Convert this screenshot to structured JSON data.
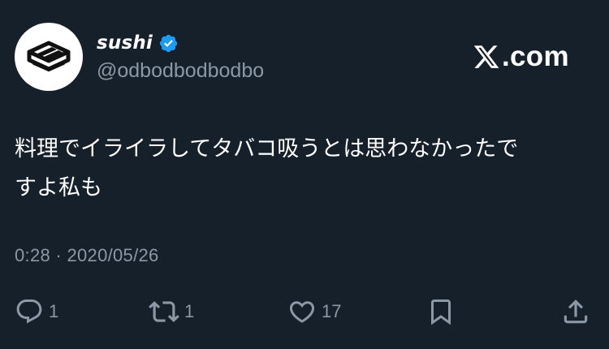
{
  "tweet": {
    "author": {
      "display_name": "sushi",
      "handle": "@odbodbodbodbo",
      "verified": true,
      "avatar_icon": "sushi-box-logo-icon"
    },
    "brand": {
      "icon": "x-logo-icon",
      "domain": ".com"
    },
    "text_lines": [
      "料理でイライラしてタバコ吸うとは思わなかったで",
      "すよ私も"
    ],
    "timestamp": "0:28 · 2020/05/26",
    "actions": {
      "reply": {
        "icon": "reply-icon",
        "count": "1"
      },
      "retweet": {
        "icon": "retweet-icon",
        "count": "1"
      },
      "like": {
        "icon": "heart-icon",
        "count": "17"
      },
      "bookmark": {
        "icon": "bookmark-icon"
      },
      "share": {
        "icon": "share-icon"
      }
    },
    "colors": {
      "background": "#15202b",
      "text_primary": "#ffffff",
      "text_secondary": "#8b98a5",
      "verified_badge": "#1d9bf0"
    }
  }
}
